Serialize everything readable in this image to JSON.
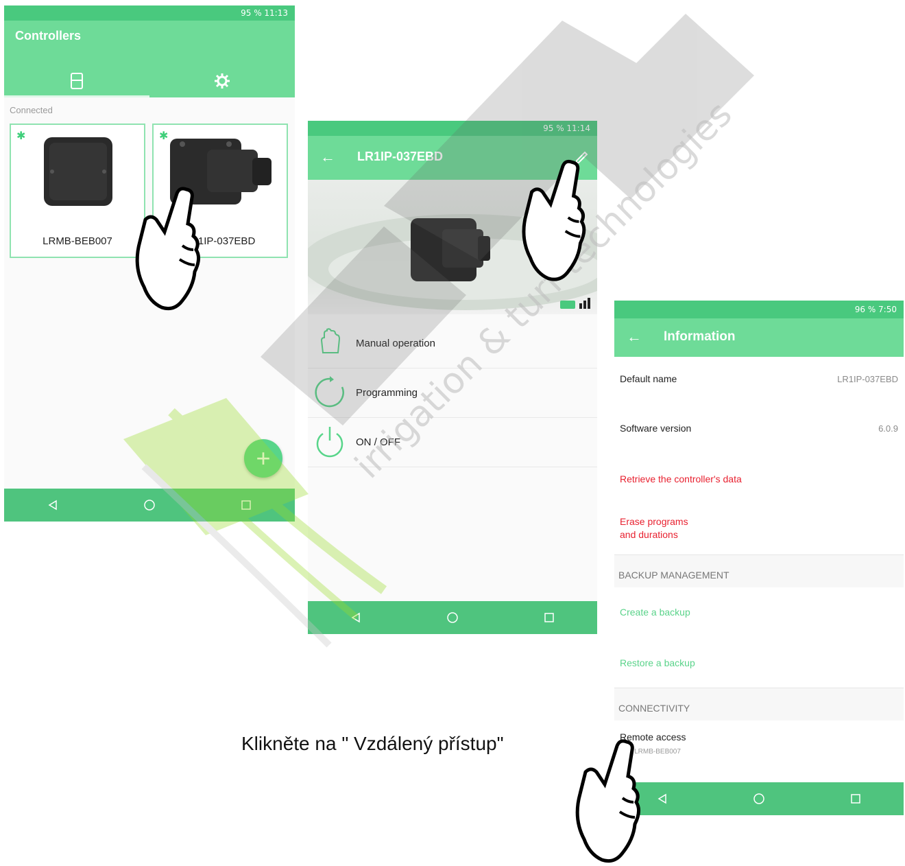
{
  "screen1": {
    "status": "95 % 11:13",
    "title": "Controllers",
    "section": "Connected",
    "controllers": [
      {
        "name": "LRMB-BEB007"
      },
      {
        "name": "LR1IP-037EBD"
      }
    ]
  },
  "screen2": {
    "status": "95 % 11:14",
    "title": "LR1IP-037EBD",
    "menu": [
      {
        "label": "Manual operation"
      },
      {
        "label": "Programming"
      },
      {
        "label": "ON / OFF"
      }
    ]
  },
  "screen3": {
    "status": "96 % 7:50",
    "title": "Information",
    "default_name_label": "Default name",
    "default_name_value": "LR1IP-037EBD",
    "software_label": "Software version",
    "software_value": "6.0.9",
    "retrieve_label": "Retrieve the controller's data",
    "erase_label_line1": "Erase programs",
    "erase_label_line2": "and durations",
    "backup_header": "BACKUP MANAGEMENT",
    "create_backup": "Create a backup",
    "restore_backup": "Restore a backup",
    "connectivity_header": "CONNECTIVITY",
    "remote_label": "Remote access",
    "remote_sub": "via : LRMB-BEB007"
  },
  "caption": "Klikněte na \" Vzdálený přístup\"",
  "watermark_text": "irrigation & turf technologies",
  "colors": {
    "green": "#6edb98",
    "dark_green": "#4fc47e",
    "red": "#e8202f"
  }
}
